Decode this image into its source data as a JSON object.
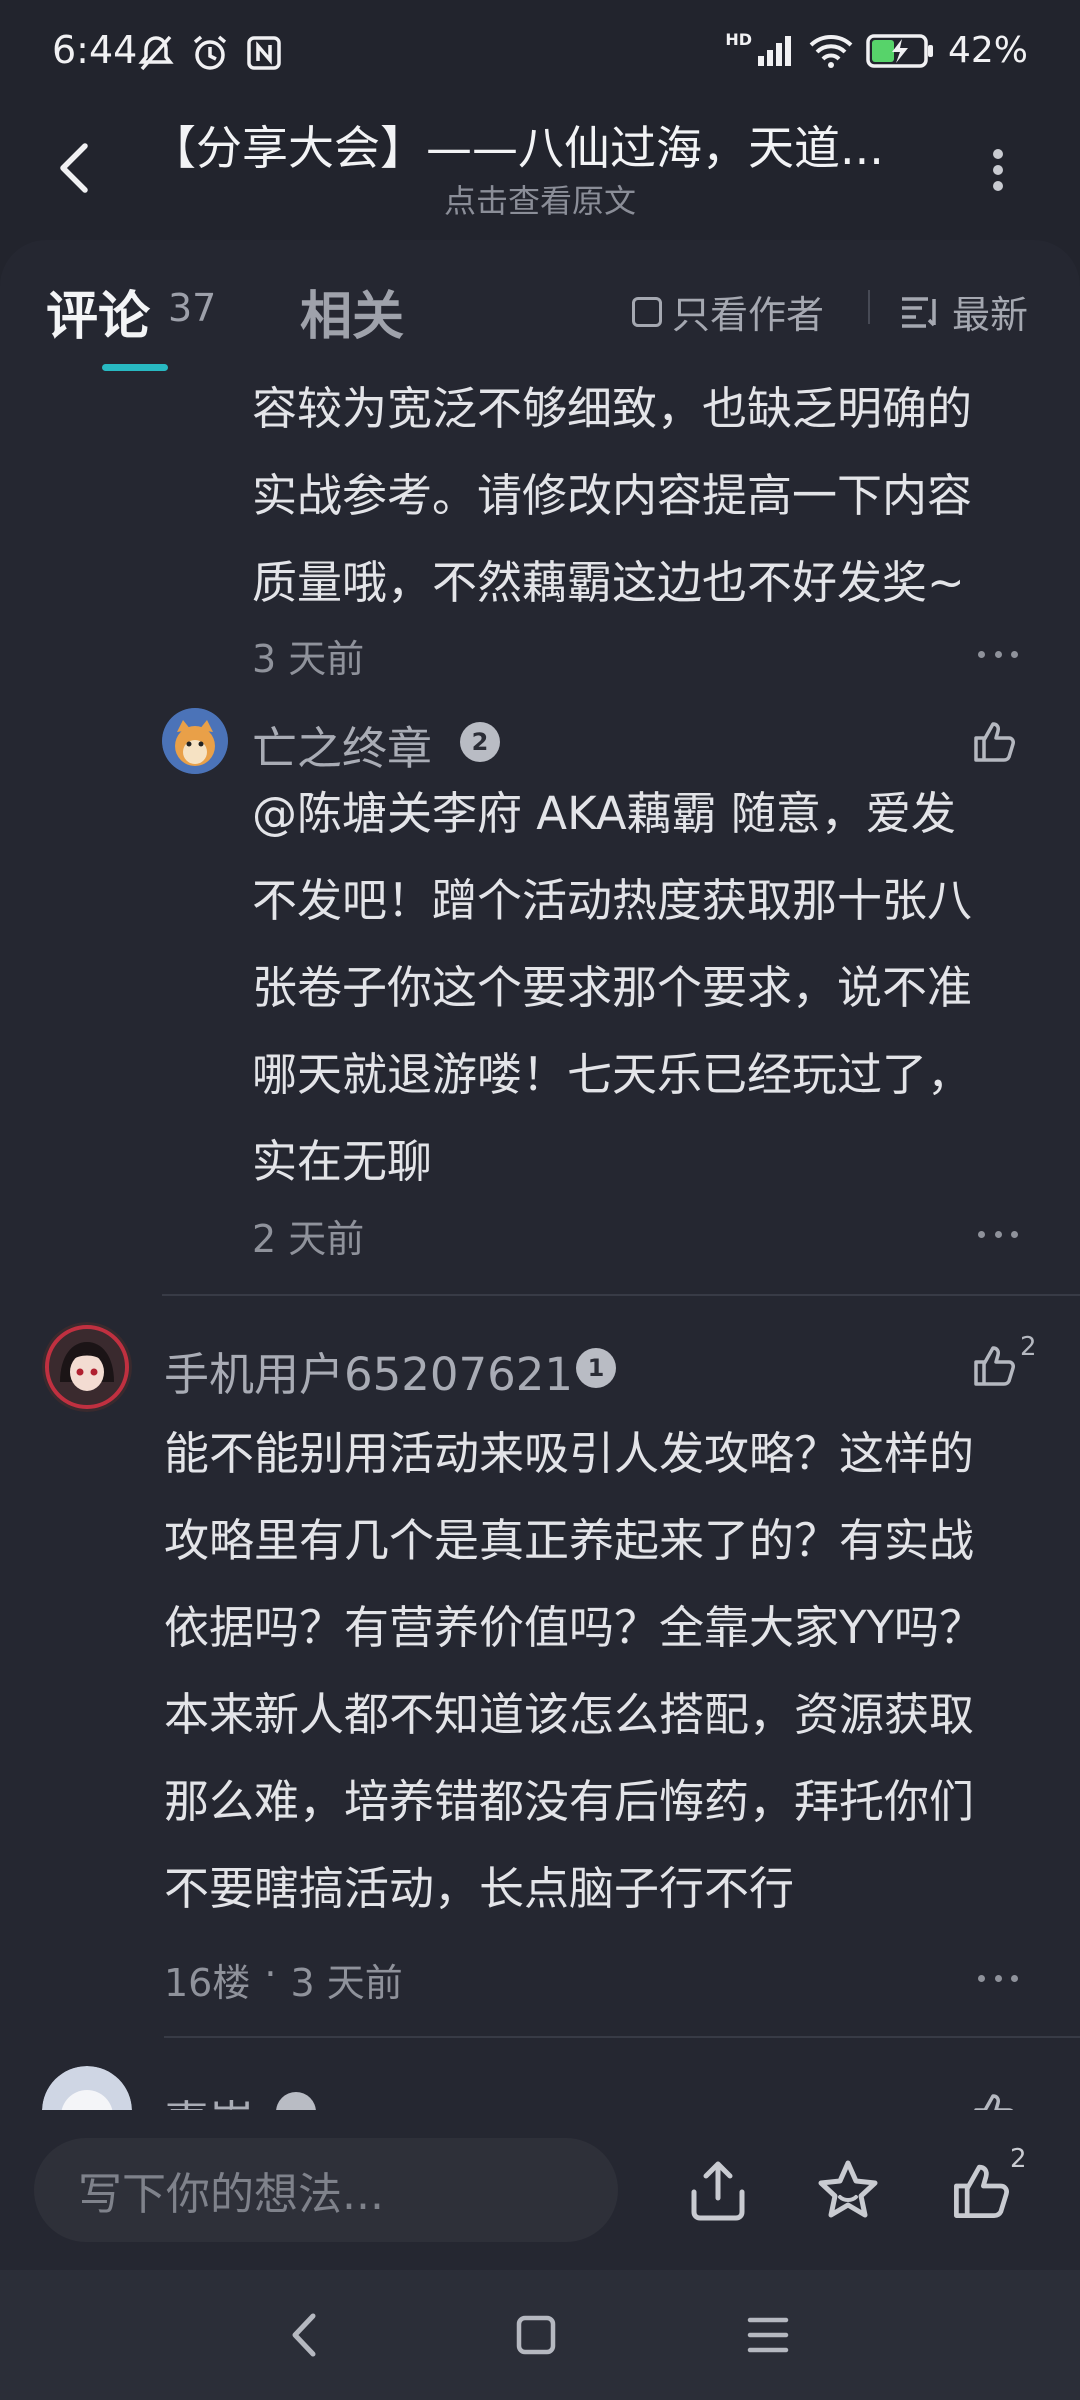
{
  "status_bar": {
    "time": "6:44",
    "battery": "42%",
    "network": "HD"
  },
  "header": {
    "title": "【分享大会】——八仙过海，天道...",
    "subtitle": "点击查看原文"
  },
  "tabs": {
    "comments_label": "评论",
    "comments_count": "37",
    "related_label": "相关",
    "only_author_label": "只看作者",
    "sort_label": "最新"
  },
  "comments": [
    {
      "lines": [
        "容较为宽泛不够细致，也缺乏明确的",
        "实战参考。请修改内容提高一下内容",
        "质量哦，不然藕霸这边也不好发奖~"
      ],
      "time": "3 天前"
    },
    {
      "username": "亡之终章",
      "level": "2",
      "lines": [
        "@陈塘关李府 AKA藕霸  随意，爱发",
        "不发吧！蹭个活动热度获取那十张八",
        "张卷子你这个要求那个要求，说不准",
        "哪天就退游喽！七天乐已经玩过了，",
        "实在无聊"
      ],
      "time": "2 天前"
    },
    {
      "username": "手机用户65207621",
      "level": "1",
      "like_count": "2",
      "lines": [
        "能不能别用活动来吸引人发攻略？这样的",
        "攻略里有几个是真正养起来了的？有实战",
        "依据吗？有营养价值吗？全靠大家YY吗？",
        "本来新人都不知道该怎么搭配，资源获取",
        "那么难，培养错都没有后悔药，拜托你们",
        "不要瞎搞活动，长点脑子行不行"
      ],
      "floor": "16楼",
      "separator": "·",
      "time": "3 天前"
    },
    {
      "username": "喜崇"
    }
  ],
  "bottom_bar": {
    "input_placeholder": "写下你的想法...",
    "like_count": "2"
  },
  "colors": {
    "background": "#22242d",
    "sheet": "#252731",
    "accent": "#28b9c2",
    "text_primary": "#e3e4e8",
    "text_secondary": "#8f929b"
  }
}
